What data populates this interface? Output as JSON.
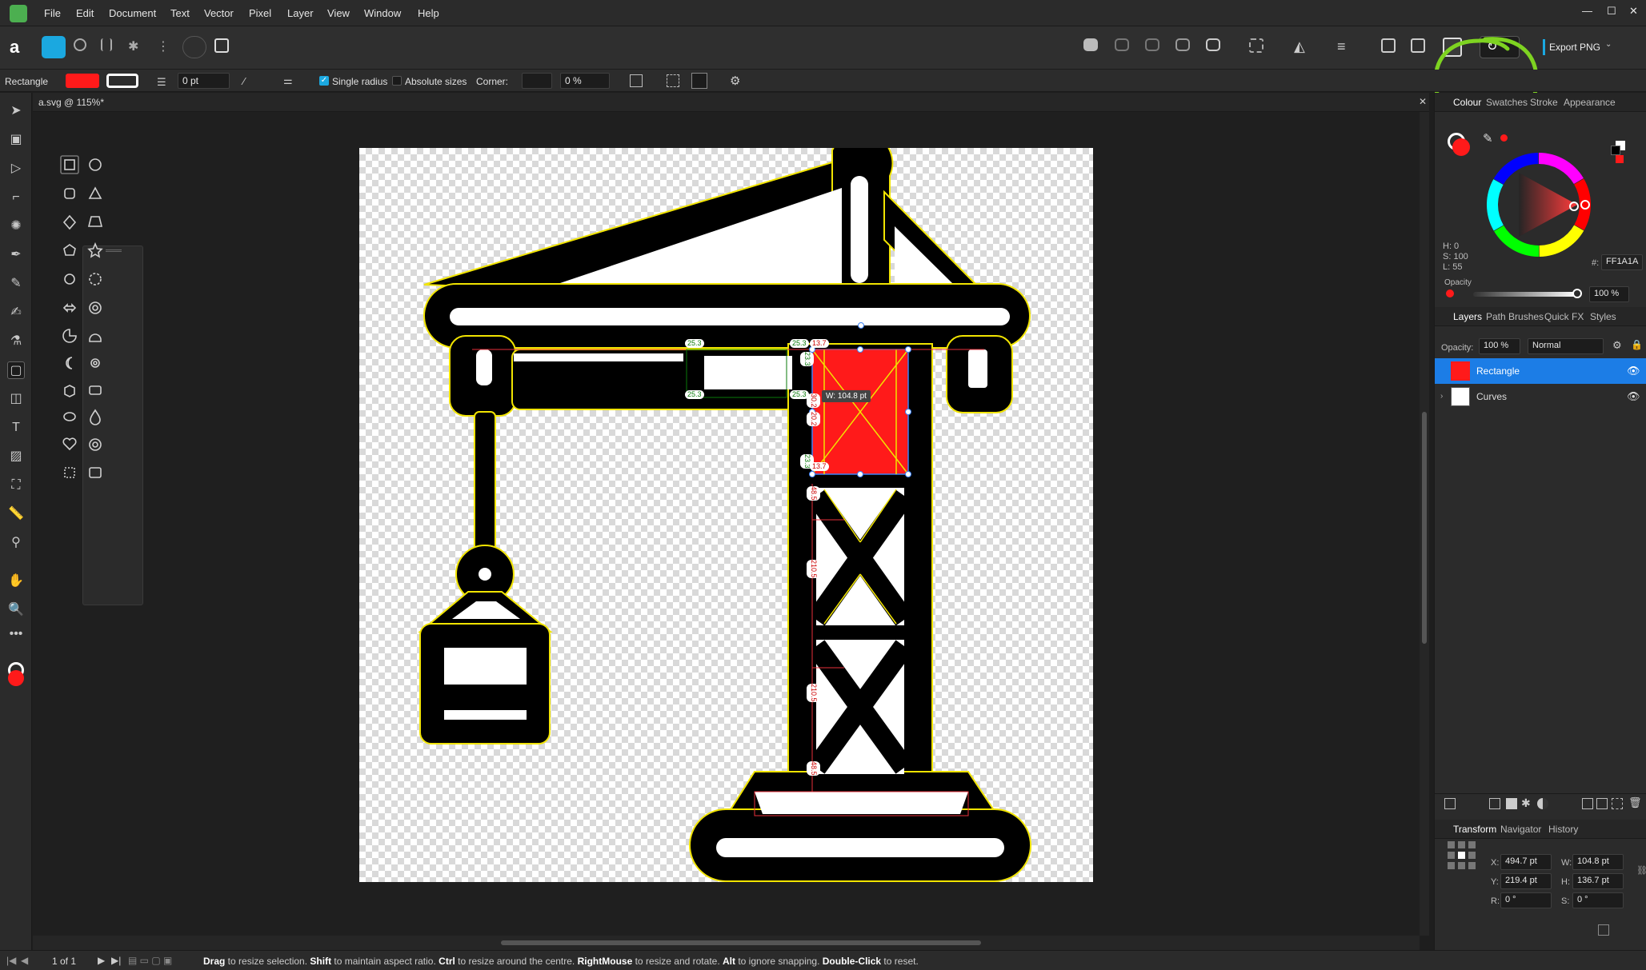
{
  "menu": [
    "File",
    "Edit",
    "Document",
    "Text",
    "Vector",
    "Pixel",
    "Layer",
    "View",
    "Window",
    "Help"
  ],
  "window_controls": {
    "minimize": "—",
    "maximize": "☐",
    "close": "✕"
  },
  "toolbar": {
    "export_label": "Export PNG"
  },
  "context": {
    "tool_name": "Rectangle",
    "fill_color": "#ff1a1a",
    "stroke_width": "0 pt",
    "single_radius_label": "Single radius",
    "single_radius_checked": true,
    "absolute_sizes_label": "Absolute sizes",
    "absolute_sizes_checked": false,
    "corner_label": "Corner:",
    "corner_value": "0 %"
  },
  "document": {
    "tab_title": "a.svg @ 115%*",
    "close": "✕"
  },
  "canvas_labels": {
    "width_tooltip": "W: 104.8 pt",
    "dims": [
      "25.3",
      "25.3",
      "13.7",
      "25.3",
      "25.3",
      "23.3",
      "20.2",
      "30.2",
      "23.3",
      "13.7",
      "48.5",
      "210.5",
      "210.5",
      "48.5"
    ]
  },
  "colour_panel": {
    "tabs": [
      "Colour",
      "Swatches",
      "Stroke",
      "Appearance"
    ],
    "h": "H: 0",
    "s": "S: 100",
    "l": "L: 55",
    "hex_label": "#:",
    "hex": "FF1A1A",
    "opacity_label": "Opacity",
    "opacity_value": "100 %",
    "color": "#ff1a1a"
  },
  "layers_panel": {
    "tabs": [
      "Layers",
      "Path Brushes",
      "Quick FX",
      "Styles"
    ],
    "opacity_label": "Opacity:",
    "opacity_value": "100 %",
    "blend_mode": "Normal",
    "layers": [
      {
        "name": "Rectangle",
        "selected": true
      },
      {
        "name": "Curves",
        "selected": false
      }
    ]
  },
  "transform_panel": {
    "tabs": [
      "Transform",
      "Navigator",
      "History"
    ],
    "x_label": "X:",
    "x": "494.7 pt",
    "y_label": "Y:",
    "y": "219.4 pt",
    "w_label": "W:",
    "w": "104.8 pt",
    "h_label": "H:",
    "h": "136.7 pt",
    "r_label": "R:",
    "r": "0 °",
    "s_label": "S:",
    "s": "0 °"
  },
  "status": {
    "page": "1 of 1",
    "drag": "Drag",
    "t1": " to resize selection. ",
    "shift": "Shift",
    "t2": " to maintain aspect ratio. ",
    "ctrl": "Ctrl",
    "t3": " to resize around the centre. ",
    "rightmouse": "RightMouse",
    "t4": " to resize and rotate. ",
    "alt": "Alt",
    "t5": " to ignore snapping. ",
    "dblclick": "Double-Click",
    "t6": " to reset."
  }
}
